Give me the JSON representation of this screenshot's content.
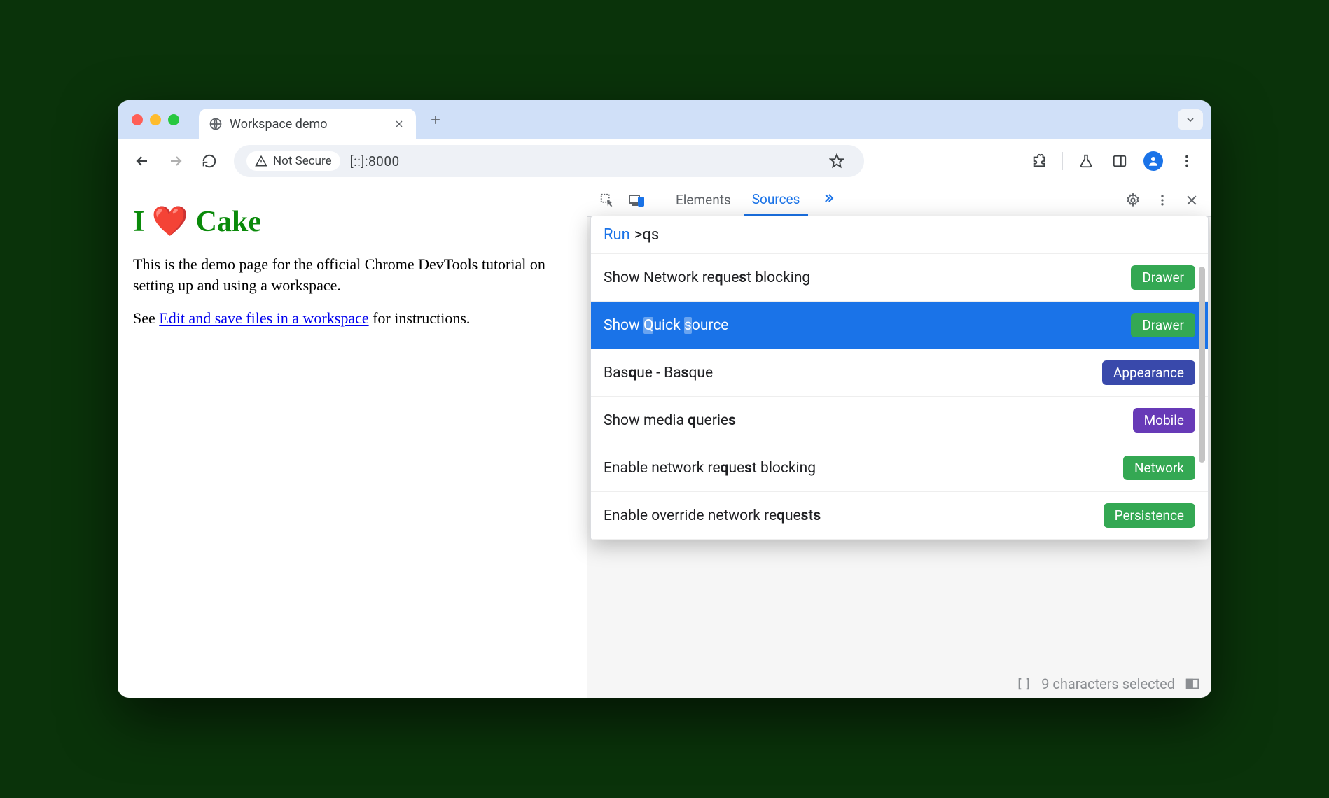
{
  "tabstrip": {
    "tab_title": "Workspace demo"
  },
  "toolbar": {
    "security_label": "Not Secure",
    "url": "[::]:8000"
  },
  "page": {
    "heading": "I ❤️ Cake",
    "para1": "This is the demo page for the official Chrome DevTools tutorial on setting up and using a workspace.",
    "para2_prefix": "See ",
    "link_text": "Edit and save files in a workspace",
    "para2_suffix": " for instructions."
  },
  "devtools": {
    "tabs": {
      "elements": "Elements",
      "sources": "Sources"
    },
    "status_text": "9 characters selected"
  },
  "cmd": {
    "run_label": "Run",
    "prefix": ">",
    "query": "qs",
    "items": [
      {
        "label_html": "Show Network re<b>q</b>ue<b>s</b>t blocking",
        "badge": "Drawer",
        "badge_color": "#34a853",
        "selected": false
      },
      {
        "label_html": "Show <span class='hl'>Q</span>uick <span class='hl'>s</span>ource",
        "badge": "Drawer",
        "badge_color": "#34a853",
        "selected": true
      },
      {
        "label_html": "Bas<b>q</b>ue - Ba<b>s</b>que",
        "badge": "Appearance",
        "badge_color": "#3949ab",
        "selected": false
      },
      {
        "label_html": "Show media <b>q</b>uerie<b>s</b>",
        "badge": "Mobile",
        "badge_color": "#673ab7",
        "selected": false
      },
      {
        "label_html": "Enable network re<b>q</b>ue<b>s</b>t blocking",
        "badge": "Network",
        "badge_color": "#34a853",
        "selected": false
      },
      {
        "label_html": "Enable override network re<b>q</b>ue<b>s</b>t<b>s</b>",
        "badge": "Persistence",
        "badge_color": "#34a853",
        "selected": false
      }
    ]
  }
}
